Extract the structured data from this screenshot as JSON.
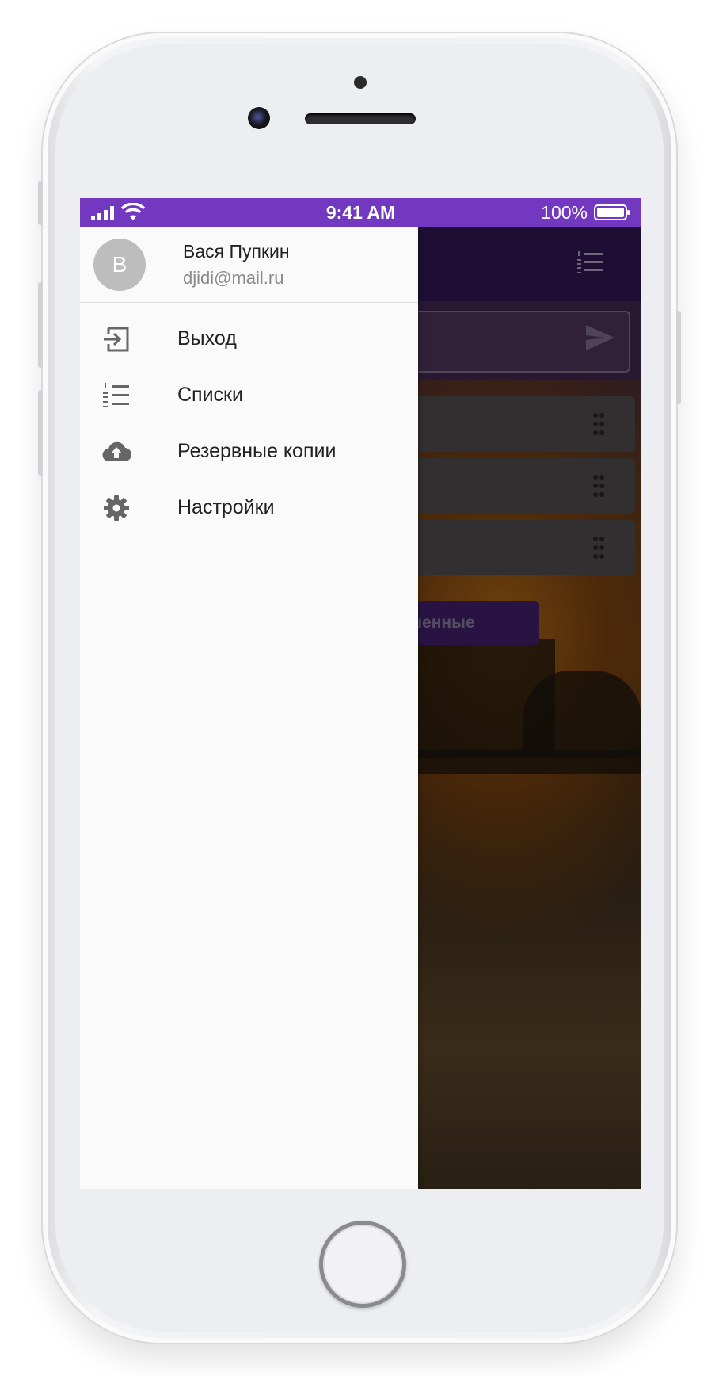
{
  "status_bar": {
    "time": "9:41 AM",
    "battery": "100%"
  },
  "user": {
    "avatar_letter": "В",
    "name": "Вася Пупкин",
    "email": "djidi@mail.ru"
  },
  "menu": [
    {
      "label": "Выход",
      "icon": "exit-icon"
    },
    {
      "label": "Списки",
      "icon": "list-numbered-icon"
    },
    {
      "label": "Резервные копии",
      "icon": "cloud-upload-icon"
    },
    {
      "label": "Настройки",
      "icon": "gear-icon"
    }
  ],
  "background_app": {
    "completed_button_partial": "ершенные"
  },
  "colors": {
    "status_bar": "#7238c0",
    "toolbar": "#3a1a60",
    "drawer": "#fafafa",
    "avatar": "#bdbdbd"
  }
}
